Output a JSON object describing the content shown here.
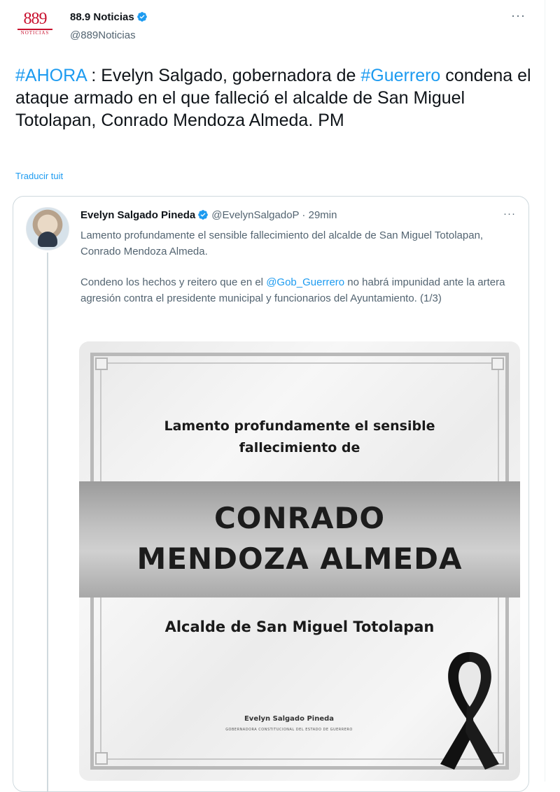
{
  "header": {
    "logo_number": "889",
    "logo_subtitle": "NOTICIAS",
    "author_name": "88.9 Noticias",
    "author_handle": "@889Noticias",
    "more_label": "···",
    "verified_icon": "verified-badge-icon"
  },
  "tweet": {
    "hashtag1": "#AHORA",
    "text_part1": " : Evelyn Salgado, gobernadora de ",
    "hashtag2": "#Guerrero",
    "text_part2": " condena el ataque armado en el que falleció el alcalde de San Miguel Totolapan, Conrado Mendoza Almeda. PM",
    "translate_label": "Traducir tuit"
  },
  "quote": {
    "author_name": "Evelyn Salgado Pineda",
    "author_handle": "@EvelynSalgadoP · 29min",
    "more_label": "···",
    "paragraph1": "Lamento profundamente el sensible fallecimiento del alcalde de San Miguel Totolapan, Conrado Mendoza Almeda.",
    "paragraph2_part1": "Condeno los hechos y reitero que en el ",
    "mention": "@Gob_Guerrero",
    "paragraph2_part2": " no habrá impunidad ante la artera agresión contra el presidente municipal y funcionarios del Ayuntamiento. (1/3)"
  },
  "card": {
    "top_line1": "Lamento profundamente el sensible",
    "top_line2": "fallecimiento de",
    "name_line1": "CONRADO",
    "name_line2": "MENDOZA ALMEDA",
    "subtitle": "Alcalde de San Miguel Totolapan",
    "signature_name": "Evelyn Salgado Pineda",
    "signature_title": "GOBERNADORA CONSTITUCIONAL DEL ESTADO DE GUERRERO",
    "ribbon_icon": "mourning-ribbon-icon"
  },
  "colors": {
    "link": "#1d9bf0",
    "brand_red": "#c8102e",
    "secondary_text": "#536471"
  }
}
